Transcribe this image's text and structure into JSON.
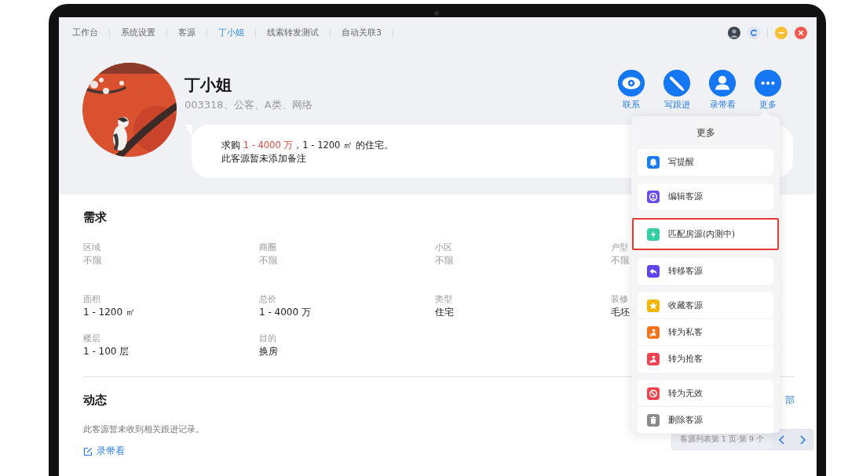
{
  "tabs": [
    {
      "label": "工作台",
      "selected": false
    },
    {
      "label": "系统设置",
      "selected": false
    },
    {
      "label": "客源",
      "selected": false
    },
    {
      "label": "丁小姐",
      "selected": true
    },
    {
      "label": "线索转发测试",
      "selected": false
    },
    {
      "label": "自动关联3",
      "selected": false
    }
  ],
  "profile": {
    "name": "丁小姐",
    "subtitle": "003318、公客、A类、网络",
    "summary": [
      {
        "text": "求购 ",
        "highlight": false
      },
      {
        "text": "1 - 4000 万",
        "highlight": true
      },
      {
        "text": "，1 - 1200 ㎡ 的住宅。",
        "highlight": false
      }
    ],
    "note": "此客源暂未添加备注"
  },
  "actions": [
    {
      "label": "联系",
      "kind": "eye"
    },
    {
      "label": "写跟进",
      "kind": "pencil"
    },
    {
      "label": "录带看",
      "kind": "person"
    },
    {
      "label": "更多",
      "kind": "dots"
    }
  ],
  "requirements": {
    "title": "需求",
    "fields": [
      {
        "label": "区域",
        "value": "不限",
        "muted": true
      },
      {
        "label": "商圈",
        "value": "不限",
        "muted": true
      },
      {
        "label": "小区",
        "value": "不限",
        "muted": true
      },
      {
        "label": "户型",
        "value": "不限",
        "muted": true
      },
      {
        "label": "面积",
        "value": "1 - 1200 ㎡",
        "muted": false
      },
      {
        "label": "总价",
        "value": "1 - 4000 万",
        "muted": false
      },
      {
        "label": "类型",
        "value": "住宅",
        "muted": false
      },
      {
        "label": "装修",
        "value": "毛坯",
        "muted": false
      },
      {
        "label": "楼层",
        "value": "1 - 100 层",
        "muted": false
      },
      {
        "label": "目的",
        "value": "换房",
        "muted": false
      }
    ]
  },
  "activity": {
    "title": "动态",
    "all_link": "部",
    "empty": "此客源暂未收到相关跟进记录。",
    "action": "录带看"
  },
  "pager": {
    "text": "客源列表第 1 页·第 9 个"
  },
  "more_menu": {
    "title": "更多",
    "groups": [
      {
        "items": [
          {
            "label": "写提醒",
            "kind": "bell",
            "color": "#1a7cf5",
            "highlighted": false
          }
        ]
      },
      {
        "items": [
          {
            "label": "编辑客源",
            "kind": "user",
            "color": "#6a4cf0",
            "highlighted": false
          }
        ]
      },
      {
        "items": [
          {
            "label": "匹配房源(内测中)",
            "kind": "bolt",
            "color": "#34cda4",
            "highlighted": true
          }
        ]
      },
      {
        "items": [
          {
            "label": "转移客源",
            "kind": "transfer",
            "color": "#6045ee",
            "highlighted": false
          }
        ]
      },
      {
        "items": [
          {
            "label": "收藏客源",
            "kind": "star",
            "color": "#f5b400",
            "highlighted": false
          },
          {
            "label": "转为私客",
            "kind": "private",
            "color": "#f5731a",
            "highlighted": false
          },
          {
            "label": "转为抢客",
            "kind": "grab",
            "color": "#f0434f",
            "highlighted": false
          }
        ]
      },
      {
        "items": [
          {
            "label": "转为无效",
            "kind": "ban",
            "color": "#f0434f",
            "highlighted": false
          },
          {
            "label": "删除客源",
            "kind": "trash",
            "color": "#8a8a8a",
            "highlighted": false
          }
        ]
      }
    ]
  }
}
